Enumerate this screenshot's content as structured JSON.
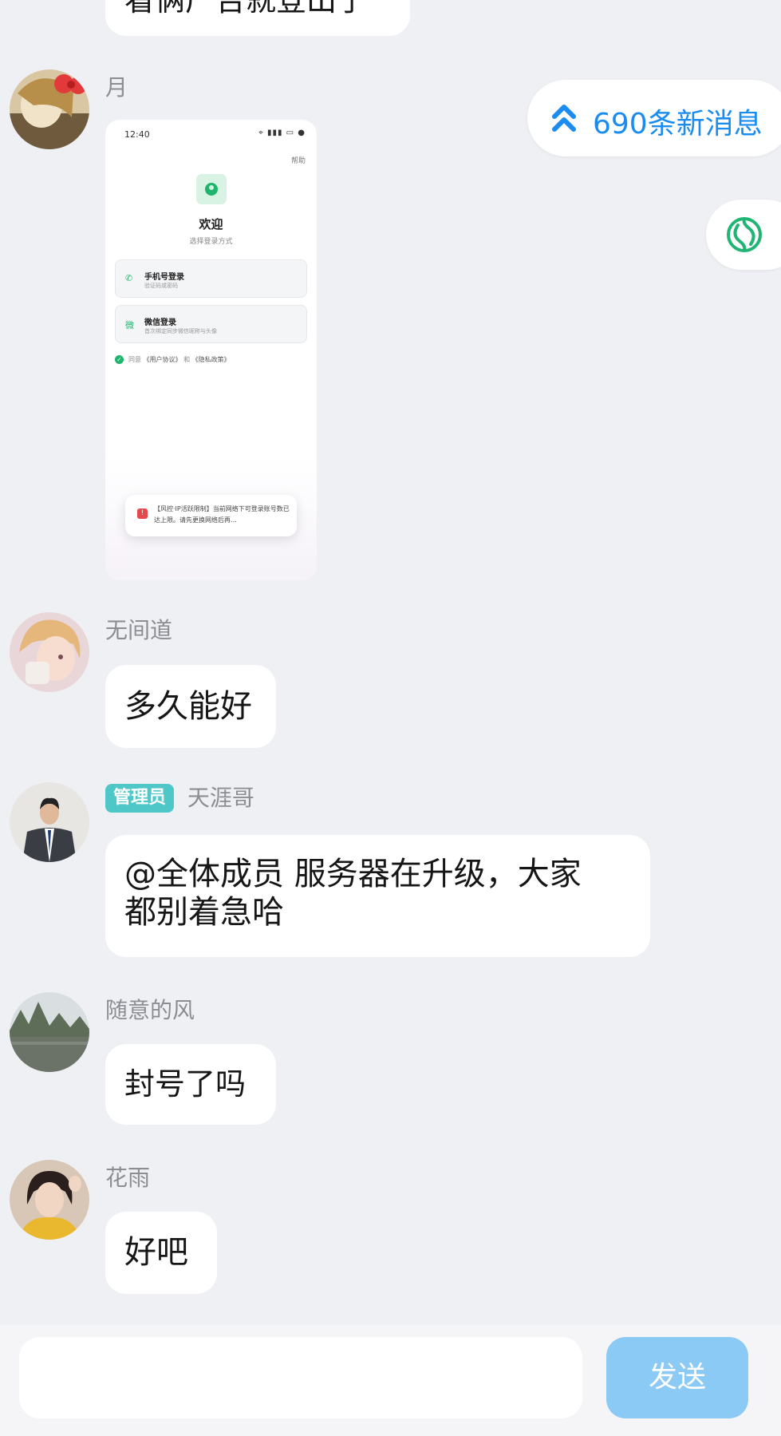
{
  "messages": [
    {
      "text": "看俩广告就登出了"
    },
    {
      "sender": "月",
      "type": "image"
    },
    {
      "sender": "无间道",
      "text": "多久能好"
    },
    {
      "role": "管理员",
      "sender": "天涯哥",
      "text": "@全体成员 服务器在升级，大家\n都别着急哈"
    },
    {
      "sender": "随意的风",
      "text": "封号了吗"
    },
    {
      "sender": "花雨",
      "text": "好吧"
    }
  ],
  "shared_screenshot": {
    "time": "12:40",
    "status_icons": "⌖ ▮▮▮ ▭ ●",
    "help": "帮助",
    "welcome": "欢迎",
    "welcome_sub": "选择登录方式",
    "option1_title": "手机号登录",
    "option1_sub": "验证码或密码",
    "option2_title": "微信登录",
    "option2_sub": "首次绑定同步微信昵称与头像",
    "agree_prefix": "同意",
    "agree_link1": "《用户协议》",
    "agree_and": "和",
    "agree_link2": "《隐私政策》",
    "toast_text": "【风控·IP活跃限制】当前网络下可登录账号数已达上限。请先更换网络后再…"
  },
  "new_messages": {
    "label": "690条新消息",
    "color": "#1a8cf0"
  },
  "input": {
    "placeholder": "",
    "value": ""
  },
  "send_button": {
    "label": "发送",
    "color": "#8bcaf5"
  },
  "colors": {
    "background": "#eff0f4",
    "bubble": "#ffffff",
    "role_tag": "#4fc7c9",
    "accent_green": "#1db46c"
  }
}
